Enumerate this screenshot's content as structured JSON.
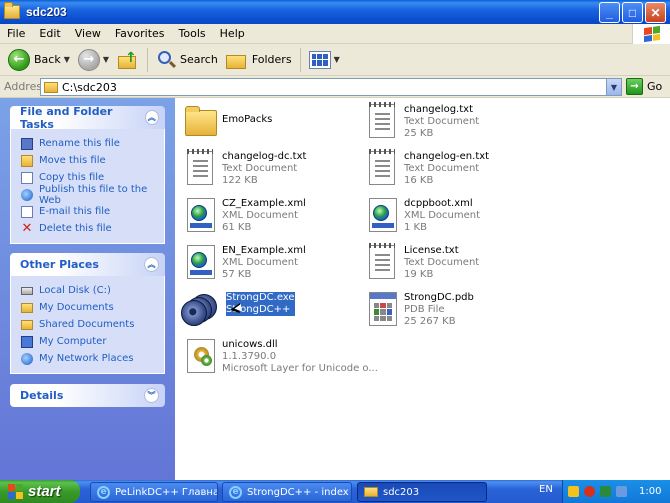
{
  "window": {
    "title": "sdc203"
  },
  "menu": [
    "File",
    "Edit",
    "View",
    "Favorites",
    "Tools",
    "Help"
  ],
  "toolbar": {
    "back_label": "Back",
    "search_label": "Search",
    "folders_label": "Folders"
  },
  "address": {
    "label": "Address",
    "value": "C:\\sdc203",
    "go_label": "Go"
  },
  "panes": {
    "file_tasks": {
      "title": "File and Folder Tasks",
      "items": [
        {
          "label": "Rename this file",
          "icon": "rename-icon"
        },
        {
          "label": "Move this file",
          "icon": "move-icon"
        },
        {
          "label": "Copy this file",
          "icon": "copy-icon"
        },
        {
          "label": "Publish this file to the Web",
          "icon": "publish-web-icon"
        },
        {
          "label": "E-mail this file",
          "icon": "email-icon"
        },
        {
          "label": "Delete this file",
          "icon": "delete-icon"
        }
      ]
    },
    "other_places": {
      "title": "Other Places",
      "items": [
        {
          "label": "Local Disk (C:)",
          "icon": "disk-icon"
        },
        {
          "label": "My Documents",
          "icon": "folder-icon"
        },
        {
          "label": "Shared Documents",
          "icon": "folder-icon"
        },
        {
          "label": "My Computer",
          "icon": "computer-icon"
        },
        {
          "label": "My Network Places",
          "icon": "network-icon"
        }
      ]
    },
    "details": {
      "title": "Details"
    }
  },
  "files": [
    {
      "name": "EmoPacks",
      "type": "",
      "size": "",
      "icon": "folder-icon"
    },
    {
      "name": "changelog.txt",
      "type": "Text Document",
      "size": "25 KB",
      "icon": "text-document-icon"
    },
    {
      "name": "changelog-dc.txt",
      "type": "Text Document",
      "size": "122 KB",
      "icon": "text-document-icon"
    },
    {
      "name": "changelog-en.txt",
      "type": "Text Document",
      "size": "16 KB",
      "icon": "text-document-icon"
    },
    {
      "name": "CZ_Example.xml",
      "type": "XML Document",
      "size": "61 KB",
      "icon": "xml-document-icon"
    },
    {
      "name": "dcppboot.xml",
      "type": "XML Document",
      "size": "1 KB",
      "icon": "xml-document-icon"
    },
    {
      "name": "EN_Example.xml",
      "type": "XML Document",
      "size": "57 KB",
      "icon": "xml-document-icon"
    },
    {
      "name": "License.txt",
      "type": "Text Document",
      "size": "19 KB",
      "icon": "text-document-icon"
    },
    {
      "name": "StrongDC.exe",
      "type": "StrongDC++",
      "size": "",
      "icon": "exe-icon",
      "selected": true
    },
    {
      "name": "StrongDC.pdb",
      "type": "PDB File",
      "size": "25 267 KB",
      "icon": "pdb-file-icon"
    },
    {
      "name": "unicows.dll",
      "type": "1.1.3790.0",
      "size": "Microsoft Layer for Unicode o...",
      "icon": "dll-icon"
    }
  ],
  "taskbar": {
    "start_label": "start",
    "buttons": [
      {
        "label": "PeLinkDC++ Главна...",
        "icon": "ie-icon"
      },
      {
        "label": "StrongDC++ - index ...",
        "icon": "ie-icon"
      },
      {
        "label": "sdc203",
        "icon": "folder-icon",
        "active": true
      }
    ],
    "language": "EN",
    "clock": "1:00"
  }
}
